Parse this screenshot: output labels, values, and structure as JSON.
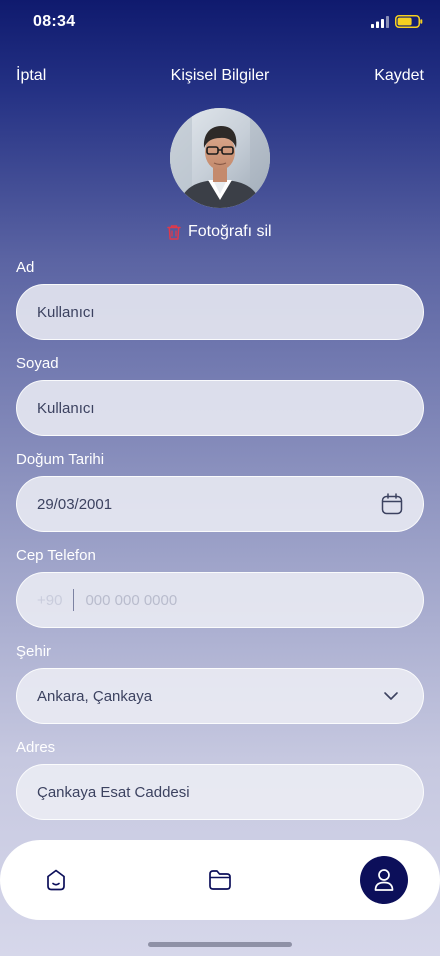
{
  "status_bar": {
    "time": "08:34",
    "battery_color": "#f5d020"
  },
  "nav": {
    "cancel_label": "İptal",
    "title": "Kişisel Bilgiler",
    "save_label": "Kaydet"
  },
  "profile": {
    "delete_photo_label": "Fotoğrafı sil",
    "delete_icon_color": "#e0394a"
  },
  "form": {
    "first_name": {
      "label": "Ad",
      "value": "Kullanıcı"
    },
    "last_name": {
      "label": "Soyad",
      "value": "Kullanıcı"
    },
    "birth_date": {
      "label": "Doğum Tarihi",
      "value": "29/03/2001",
      "icon": "calendar-icon"
    },
    "phone": {
      "label": "Cep Telefon",
      "prefix": "+90",
      "placeholder": "000 000 0000"
    },
    "city": {
      "label": "Şehir",
      "value": "Ankara, Çankaya",
      "icon": "chevron-down-icon"
    },
    "address": {
      "label": "Adres",
      "value": "Çankaya Esat Caddesi"
    }
  },
  "tabbar": {
    "tabs": [
      {
        "icon": "home-icon"
      },
      {
        "icon": "folder-icon"
      },
      {
        "icon": "profile-icon",
        "active": true
      }
    ],
    "active_color": "#0c0f5a"
  }
}
